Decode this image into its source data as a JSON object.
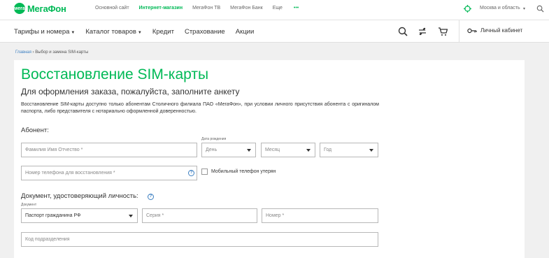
{
  "header": {
    "logo_mark": "мега",
    "logo_text": "МегаФон",
    "top_links": [
      "Основной сайт",
      "Интернет-магазин",
      "МегаФон ТВ",
      "МегаФон Банк"
    ],
    "more_label": "Еще",
    "more_dots": "•••",
    "region": "Москва и область"
  },
  "nav": {
    "items": [
      "Тарифы и номера",
      "Каталог товаров",
      "Кредит",
      "Страхование",
      "Акции"
    ],
    "account_label": "Личный кабинет"
  },
  "breadcrumb": {
    "home": "Главная",
    "separator": "›",
    "current": "Выбор и замена SIM-карты"
  },
  "page": {
    "title": "Восстановление SIM-карты",
    "subtitle": "Для оформления заказа, пожалуйста, заполните анкету",
    "description": "Восстановление SIM-карты доступно только абонентам Столичного филиала ПАО «МегаФон», при условии личного присутствия абонента с оригиналом паспорта, либо представителя с нотариально оформленной доверенностью."
  },
  "subscriber": {
    "heading": "Абонент:",
    "fullname_placeholder": "Фамилия Имя Отчество *",
    "birthdate_label": "Дата рождения",
    "day": "День",
    "month": "Месяц",
    "year": "Год",
    "phone_placeholder": "Номер телефона для восстановления *",
    "phone_help": "?",
    "lost_label": "Мобильный телефон утерян"
  },
  "document": {
    "heading": "Документ, удостоверяющий личность:",
    "help": "?",
    "type_label": "Документ",
    "type_value": "Паспорт гражданина РФ",
    "series_placeholder": "Серия *",
    "number_placeholder": "Номер *",
    "dept_code_placeholder": "Код подразделения"
  },
  "colors": {
    "brand": "#00b956",
    "link": "#3c7fc1",
    "background": "#f0f0f0"
  },
  "icons": [
    "region-icon",
    "search-icon",
    "compare-icon",
    "cart-icon",
    "key-icon",
    "help-icon"
  ]
}
